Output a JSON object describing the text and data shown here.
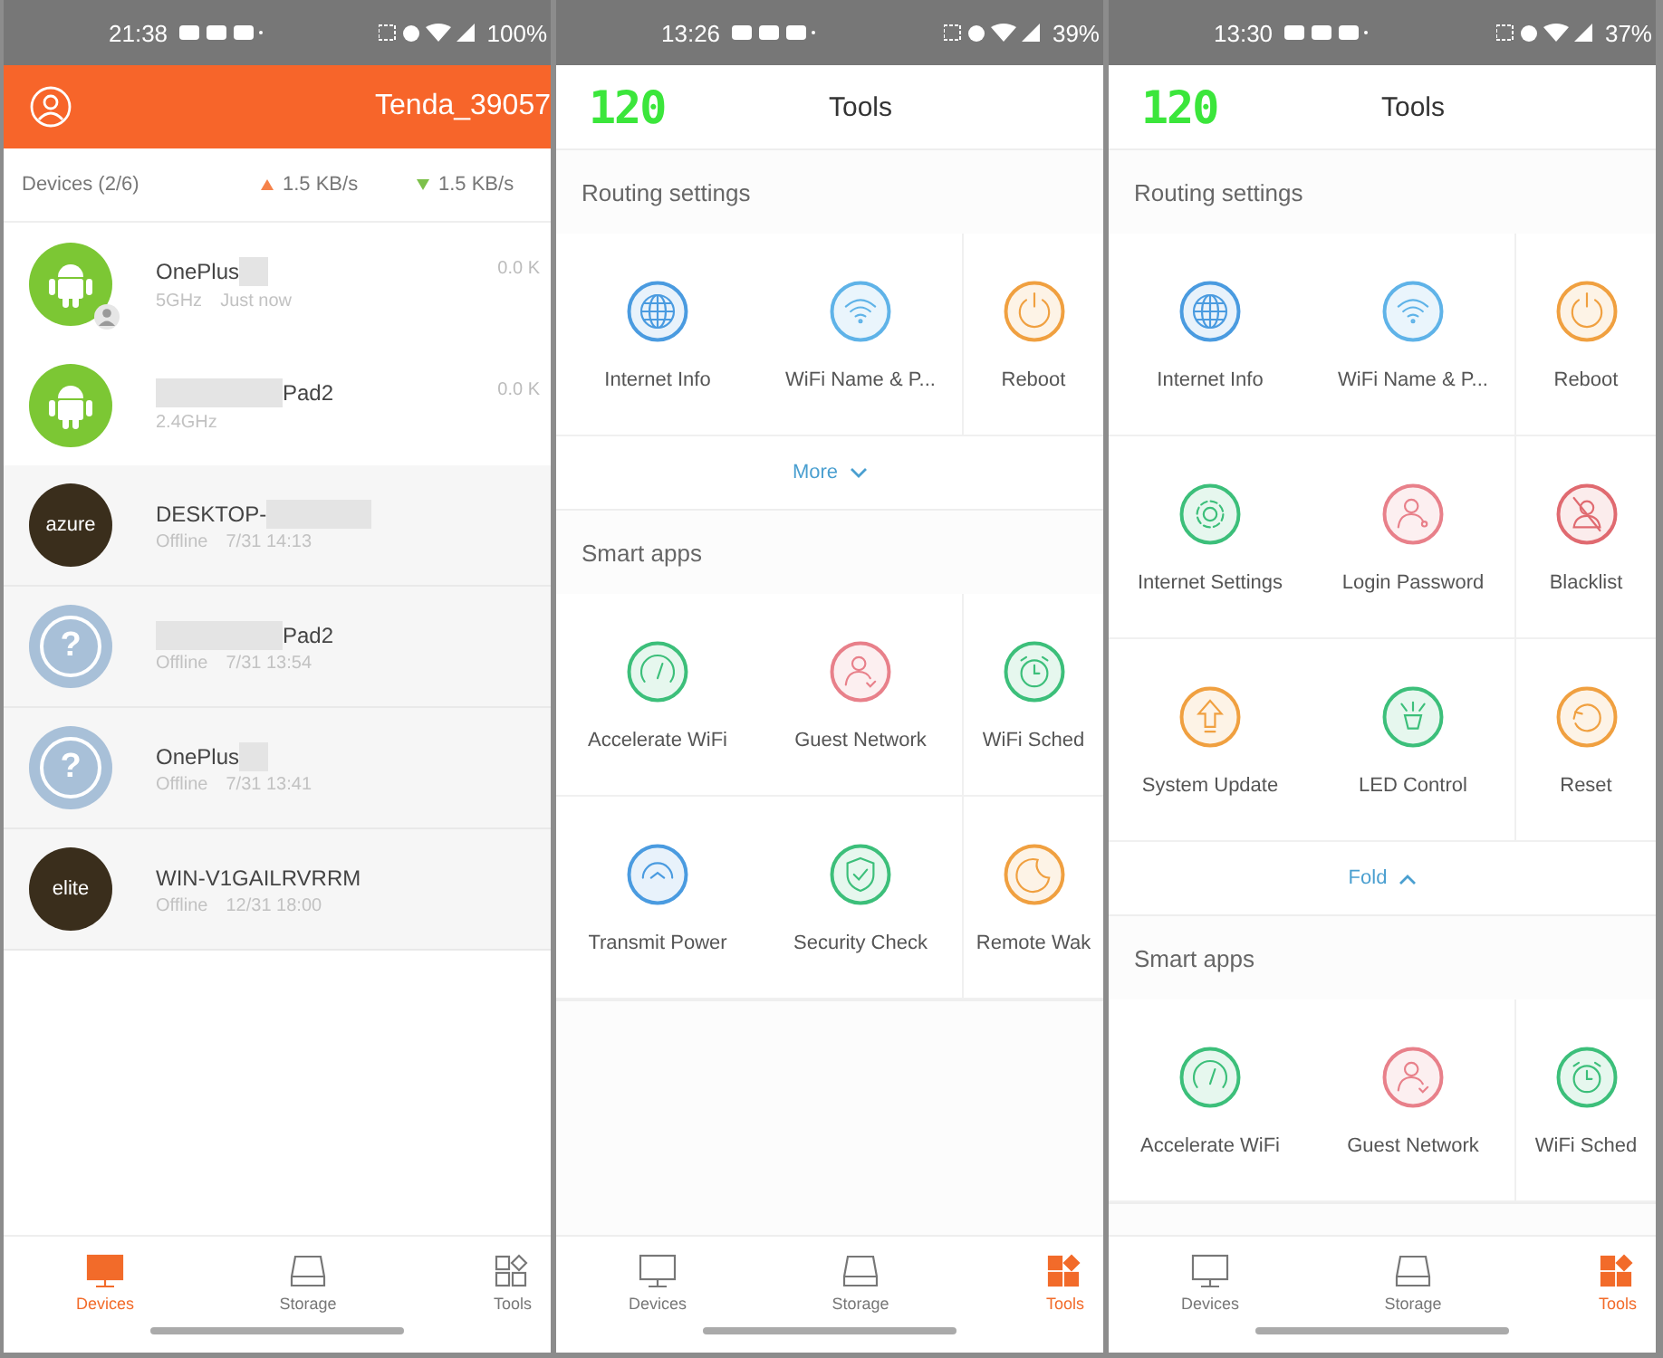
{
  "screens": [
    {
      "kind": "devices",
      "status_bar": {
        "time": "21:38",
        "battery": "100%"
      },
      "header": {
        "title": "Tenda_39057"
      },
      "summary": {
        "label": "Devices (2/6)",
        "upload": "1.5  KB/s",
        "download": "1.5  KB/s"
      },
      "devices": [
        {
          "name": "OnePlus",
          "redacted_before": false,
          "redacted_after": true,
          "detail": "5GHz",
          "time": "Just now",
          "speed": "0.0 K",
          "online": true,
          "avatar": {
            "kind": "android",
            "guest_badge": true
          }
        },
        {
          "name": "Pad2",
          "redacted_before": true,
          "redacted_after": false,
          "detail": "2.4GHz",
          "speed": "0.0 K",
          "online": true,
          "avatar": {
            "kind": "android",
            "guest_badge": false
          }
        },
        {
          "name": "DESKTOP-",
          "redacted_before": false,
          "redacted_after": true,
          "detail": "Offline",
          "time": "7/31 14:13",
          "online": false,
          "avatar": {
            "kind": "brand",
            "label": "azure"
          }
        },
        {
          "name": "Pad2",
          "redacted_before": true,
          "redacted_after": false,
          "detail": "Offline",
          "time": "7/31 13:54",
          "online": false,
          "avatar": {
            "kind": "unknown",
            "label": "?"
          }
        },
        {
          "name": "OnePlus",
          "redacted_before": false,
          "redacted_after": true,
          "detail": "Offline",
          "time": "7/31 13:41",
          "online": false,
          "avatar": {
            "kind": "unknown",
            "label": "?"
          }
        },
        {
          "name": "WIN-V1GAILRVRRM",
          "redacted_before": false,
          "redacted_after": false,
          "detail": "Offline",
          "time": "12/31 18:00",
          "online": false,
          "avatar": {
            "kind": "brand",
            "label": "elite"
          }
        }
      ],
      "nav": [
        {
          "kind": "devices",
          "label": "Devices",
          "selected": true
        },
        {
          "kind": "storage",
          "label": "Storage",
          "selected": false
        },
        {
          "kind": "tools",
          "label": "Tools",
          "selected": false
        }
      ]
    },
    {
      "kind": "tools",
      "status_bar": {
        "time": "13:26",
        "battery": "39%"
      },
      "header": {
        "logo": "120",
        "title": "Tools"
      },
      "sections": [
        {
          "title": "Routing settings",
          "items": [
            {
              "kind": "internet",
              "label": "Internet Info",
              "color": "#4a9be0"
            },
            {
              "kind": "wifi",
              "label": "WiFi Name & P...",
              "color": "#5fb3e8"
            },
            {
              "kind": "reboot",
              "label": "Reboot",
              "color": "#f0a040"
            }
          ],
          "toggle": {
            "label": "More",
            "expanded": false
          }
        },
        {
          "title": "Smart apps",
          "items": [
            {
              "kind": "accelerate",
              "label": "Accelerate WiFi",
              "color": "#3cbf7a"
            },
            {
              "kind": "guest",
              "label": "Guest Network",
              "color": "#e8808a"
            },
            {
              "kind": "schedule",
              "label": "WiFi Sched",
              "color": "#3cbf7a"
            },
            {
              "kind": "transmit",
              "label": "Transmit Power",
              "color": "#4a9be0"
            },
            {
              "kind": "security",
              "label": "Security Check",
              "color": "#3cbf7a"
            },
            {
              "kind": "remote",
              "label": "Remote Wak",
              "color": "#f0a040"
            }
          ]
        }
      ],
      "nav": [
        {
          "kind": "devices",
          "label": "Devices",
          "selected": false
        },
        {
          "kind": "storage",
          "label": "Storage",
          "selected": false
        },
        {
          "kind": "tools",
          "label": "Tools",
          "selected": true
        }
      ]
    },
    {
      "kind": "tools",
      "status_bar": {
        "time": "13:30",
        "battery": "37%"
      },
      "header": {
        "logo": "120",
        "title": "Tools"
      },
      "sections": [
        {
          "title": "Routing settings",
          "items": [
            {
              "kind": "internet",
              "label": "Internet Info",
              "color": "#4a9be0"
            },
            {
              "kind": "wifi",
              "label": "WiFi Name & P...",
              "color": "#5fb3e8"
            },
            {
              "kind": "reboot",
              "label": "Reboot",
              "color": "#f0a040"
            },
            {
              "kind": "settings",
              "label": "Internet Settings",
              "color": "#3cbf7a"
            },
            {
              "kind": "login",
              "label": "Login Password",
              "color": "#e8808a"
            },
            {
              "kind": "blacklist",
              "label": "Blacklist",
              "color": "#e06a70"
            },
            {
              "kind": "update",
              "label": "System Update",
              "color": "#f0a040"
            },
            {
              "kind": "led",
              "label": "LED Control",
              "color": "#3cbf7a"
            },
            {
              "kind": "reset",
              "label": "Reset",
              "color": "#f0a040"
            }
          ],
          "toggle": {
            "label": "Fold",
            "expanded": true
          }
        },
        {
          "title": "Smart apps",
          "items": [
            {
              "kind": "accelerate",
              "label": "Accelerate WiFi",
              "color": "#3cbf7a"
            },
            {
              "kind": "guest",
              "label": "Guest Network",
              "color": "#e8808a"
            },
            {
              "kind": "schedule",
              "label": "WiFi Sched",
              "color": "#3cbf7a"
            }
          ]
        }
      ],
      "nav": [
        {
          "kind": "devices",
          "label": "Devices",
          "selected": false
        },
        {
          "kind": "storage",
          "label": "Storage",
          "selected": false
        },
        {
          "kind": "tools",
          "label": "Tools",
          "selected": true
        }
      ]
    }
  ]
}
